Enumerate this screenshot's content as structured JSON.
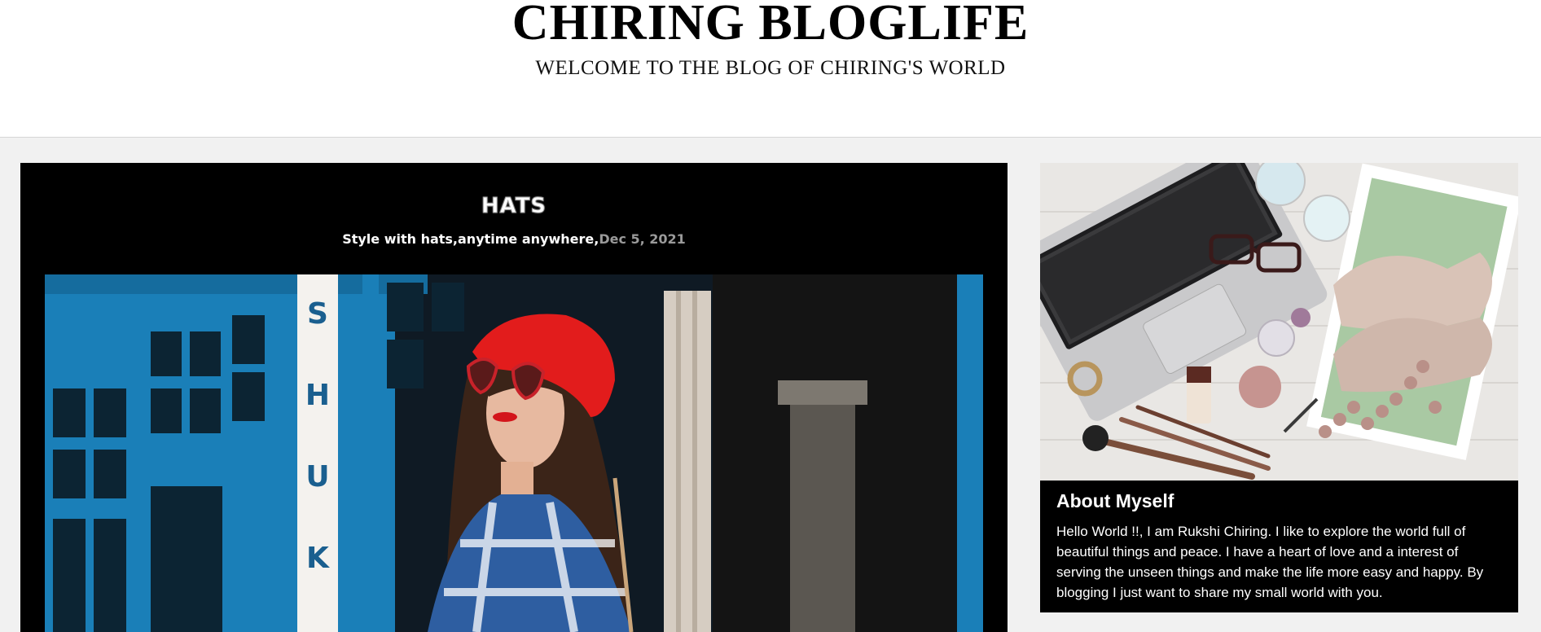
{
  "header": {
    "title": "CHIRING BLOGLIFE",
    "tagline": "WELCOME TO THE BLOG OF CHIRING'S WORLD"
  },
  "post": {
    "title": "HATS",
    "subtitle": "Style with hats,anytime anywhere,",
    "date": "Dec 5, 2021",
    "image_alt": "Woman wearing red beret and heart-shaped sunglasses",
    "storefront_sign": "SHUK"
  },
  "sidebar": {
    "image_alt": "Laptop, makeup brushes, shoes and accessories flat lay",
    "about_heading": "About Myself",
    "about_text": "Hello World !!, I am Rukshi Chiring. I like to explore the world full of beautiful things and peace. I have a heart of love and a interest of serving the unseen things and make the life more easy and happy. By blogging I just want to share my small world with you."
  },
  "colors": {
    "card_background": "#000000",
    "page_background": "#f1f1f1",
    "storefront_blue": "#1a7fb8",
    "beret_red": "#e21c1c",
    "date_gray": "#9a9a9a"
  }
}
